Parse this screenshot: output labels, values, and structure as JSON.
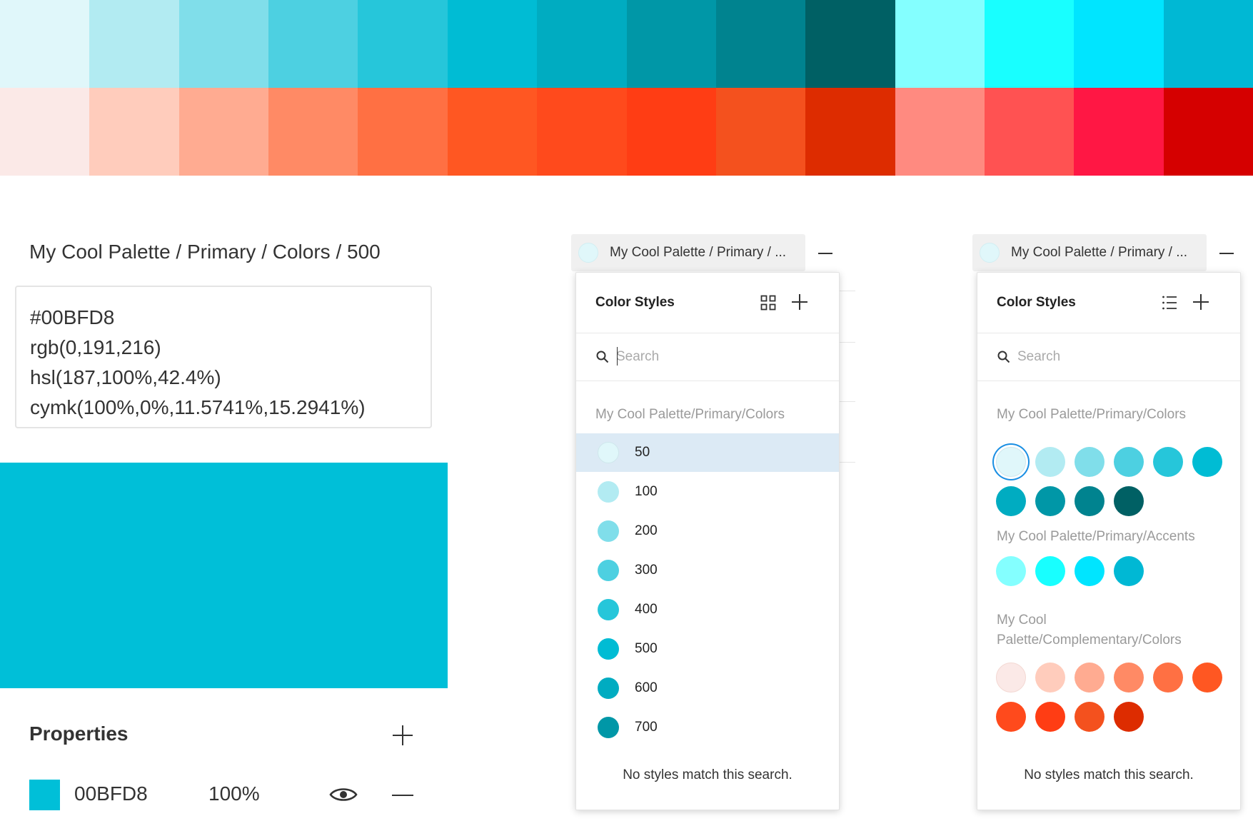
{
  "swatches": {
    "primary_row": [
      "#E0F7FA",
      "#B2EBF2",
      "#80DEEA",
      "#4DD0E1",
      "#26C6DA",
      "#00BCD4",
      "#00ACC1",
      "#0097A7",
      "#00838F",
      "#006064",
      "#84FFFF",
      "#18FFFF",
      "#00E5FF",
      "#00B8D4"
    ],
    "complementary_row": [
      "#FBE9E7",
      "#FFCCBC",
      "#FFAB91",
      "#FF8A65",
      "#FF7043",
      "#FF5722",
      "#FF4A1C",
      "#FF3D14",
      "#F4511E",
      "#DD2C00",
      "#FF8A80",
      "#FF5252",
      "#FF1744",
      "#D50000"
    ]
  },
  "inspector": {
    "style_name": "My Cool Palette / Primary / Colors / 500",
    "values": [
      "#00BFD8",
      "rgb(0,191,216)",
      "hsl(187,100%,42.4%)",
      "cymk(100%,0%,11.5741%,15.2941%)"
    ],
    "preview_color": "#00BFD8",
    "properties_title": "Properties",
    "fill": {
      "hex": "00BFD8",
      "opacity": "100%",
      "color": "#00BFD8"
    }
  },
  "list_panel": {
    "selector_label": "My Cool Palette / Primary / ...",
    "title": "Color Styles",
    "view_icon": "grid-view-icon",
    "search_placeholder": "Search",
    "group_label": "My Cool Palette/Primary/Colors",
    "items": [
      {
        "name": "50",
        "color": "#E0F7FA"
      },
      {
        "name": "100",
        "color": "#B2EBF2"
      },
      {
        "name": "200",
        "color": "#80DEEA"
      },
      {
        "name": "300",
        "color": "#4DD0E1"
      },
      {
        "name": "400",
        "color": "#26C6DA"
      },
      {
        "name": "500",
        "color": "#00BCD4"
      },
      {
        "name": "600",
        "color": "#00ACC1"
      },
      {
        "name": "700",
        "color": "#0097A7"
      }
    ],
    "active_item": "50",
    "empty_message": "No styles match this search."
  },
  "grid_panel": {
    "selector_label": "My Cool Palette / Primary / ...",
    "title": "Color Styles",
    "view_icon": "list-view-icon",
    "search_placeholder": "Search",
    "groups": [
      {
        "label": "My Cool Palette/Primary/Colors",
        "colors": [
          "#E0F7FA",
          "#B2EBF2",
          "#80DEEA",
          "#4DD0E1",
          "#26C6DA",
          "#00BCD4",
          "#00ACC1",
          "#0097A7",
          "#00838F",
          "#006064"
        ]
      },
      {
        "label": "My Cool Palette/Primary/Accents",
        "colors": [
          "#84FFFF",
          "#18FFFF",
          "#00E5FF",
          "#00B8D4"
        ]
      },
      {
        "label": "My Cool Palette/Complementary/Colors",
        "colors": [
          "#FBE9E7",
          "#FFCCBC",
          "#FFAB91",
          "#FF8A65",
          "#FF7043",
          "#FF5722",
          "#FF4A1C",
          "#FF3D14",
          "#F4511E",
          "#DD2C00"
        ]
      }
    ],
    "selected_color": "#E0F7FA",
    "empty_message": "No styles match this search."
  }
}
